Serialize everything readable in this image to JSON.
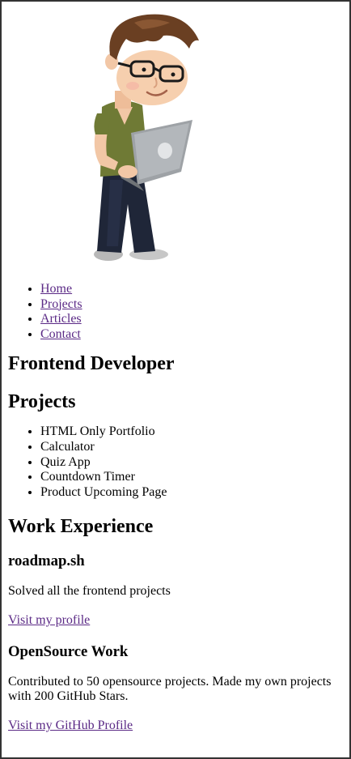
{
  "hero": {
    "illustration": "developer-with-laptop-illustration"
  },
  "nav": {
    "items": [
      {
        "label": "Home"
      },
      {
        "label": "Projects"
      },
      {
        "label": "Articles"
      },
      {
        "label": "Contact"
      }
    ]
  },
  "title": "Frontend Developer",
  "projects": {
    "heading": "Projects",
    "items": [
      "HTML Only Portfolio",
      "Calculator",
      "Quiz App",
      "Countdown Timer",
      "Product Upcoming Page"
    ]
  },
  "work": {
    "heading": "Work Experience",
    "entries": [
      {
        "title": "roadmap.sh",
        "description": "Solved all the frontend projects",
        "link_label": "Visit my profile"
      },
      {
        "title": "OpenSource Work",
        "description": "Contributed to 50 opensource projects. Made my own projects with 200 GitHub Stars.",
        "link_label": "Visit my GitHub Profile"
      }
    ]
  },
  "colors": {
    "link": "#5b2a86",
    "frame_border": "#333333",
    "text": "#000000",
    "shirt": "#6f7a35",
    "jeans": "#1f2638",
    "hair": "#6a3f22",
    "laptop": "#9ea2a6"
  }
}
